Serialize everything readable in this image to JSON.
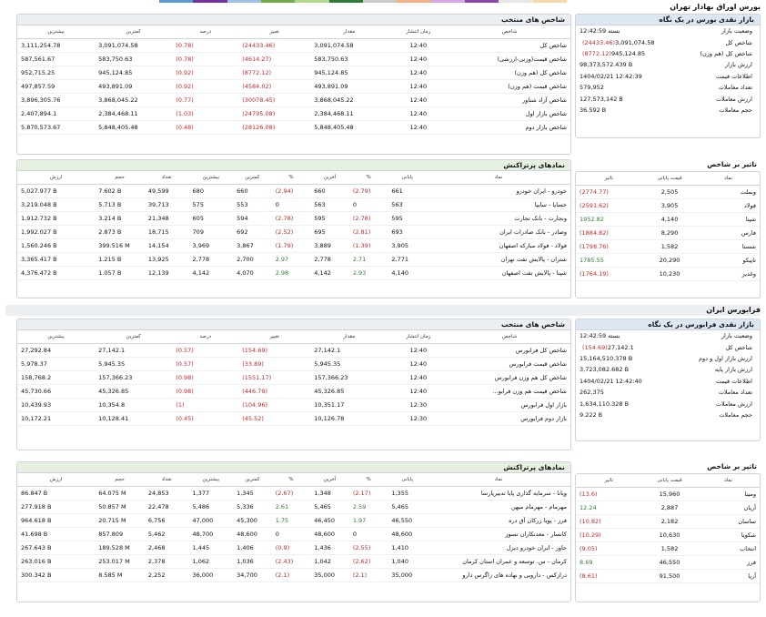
{
  "topbar_colors": [
    "#5b9bd5",
    "#7030a0",
    "#9cc3e6",
    "#70ad47",
    "#b4d88a",
    "#2e7d32",
    "#c9c9c9",
    "#f4b183",
    "#d9a7e8",
    "#8e44ad",
    "#e8e8e8",
    "#f7d6a8"
  ],
  "tse": {
    "title": "بورس اوراق بهادار تهران",
    "snapshot": {
      "title": "بازار نقدی بورس در یک نگاه",
      "rows": [
        {
          "label": "وضعیت بازار",
          "value": "بسته 12:42:59",
          "change": ""
        },
        {
          "label": "شاخص کل",
          "value": "3,091,074.58",
          "change": "(24433.46)"
        },
        {
          "label": "شاخص کل (هم وزن)",
          "value": "945,124.85",
          "change": "(8772.12)"
        },
        {
          "label": "ارزش بازار",
          "value": "98,373,572.439 B",
          "change": ""
        },
        {
          "label": "اطلاعات قیمت",
          "value": "1404/02/21 12:42:39",
          "change": ""
        },
        {
          "label": "تعداد معاملات",
          "value": "579,952",
          "change": ""
        },
        {
          "label": "ارزش معاملات",
          "value": "127,573,142 B",
          "change": ""
        },
        {
          "label": "حجم معاملات",
          "value": "36.592 B",
          "change": ""
        }
      ]
    },
    "indices": {
      "title": "شاخص های منتخب",
      "headers": [
        "شاخص",
        "زمان انتشار",
        "مقدار",
        "تغییر",
        "درصد",
        "کمترین",
        "بیشترین"
      ],
      "rows": [
        [
          "شاخص کل",
          "12:40",
          "3,091,074.58",
          "(24433.46)",
          "(0.78)",
          "3,091,074.58",
          "3,111,254.78"
        ],
        [
          "شاخص قیمت(وزنی-ارزشی)",
          "12:40",
          "583,750.63",
          "(4614.27)",
          "(0.78)",
          "583,750.63",
          "587,561.67"
        ],
        [
          "شاخص کل (هم وزن)",
          "12:40",
          "945,124.85",
          "(8772.12)",
          "(0.92)",
          "945,124.85",
          "952,715.25"
        ],
        [
          "شاخص قیمت (هم وزن)",
          "12:40",
          "493,891.09",
          "(4584.02)",
          "(0.92)",
          "493,891.09",
          "497,857.59"
        ],
        [
          "شاخص آزاد شناور",
          "12:40",
          "3,868,045.22",
          "(30078.45)",
          "(0.77)",
          "3,868,045.22",
          "3,896,305.76"
        ],
        [
          "شاخص بازار اول",
          "12:40",
          "2,384,468.11",
          "(24795.08)",
          "(1.03)",
          "2,384,468.11",
          "2,407,894.1"
        ],
        [
          "شاخص بازار دوم",
          "12:40",
          "5,848,405.48",
          "(28126.08)",
          "(0.48)",
          "5,848,405.48",
          "5,870,573.67"
        ]
      ]
    },
    "impact": {
      "title": "تاثیر بر شاخص",
      "headers": [
        "نماد",
        "قیمت پایانی",
        "تاثیر"
      ],
      "rows": [
        [
          "وبملت",
          "2,505",
          "(2774.77)"
        ],
        [
          "فولاد",
          "3,905",
          "(2591.62)"
        ],
        [
          "شپنا",
          "4,140",
          "1952.82"
        ],
        [
          "فارس",
          "8,290",
          "(1884.82)"
        ],
        [
          "شستا",
          "1,582",
          "(1798.76)"
        ],
        [
          "تاپیکو",
          "20,290",
          "1785.55"
        ],
        [
          "وغدیر",
          "10,230",
          "(1764.19)"
        ]
      ]
    },
    "active": {
      "title": "نمادهای پرتراکنش",
      "headers": [
        "نماد",
        "پایانی",
        "%",
        "آخرین",
        "%",
        "کمترین",
        "بیشترین",
        "تعداد",
        "حجم",
        "ارزش"
      ],
      "rows": [
        [
          "خودرو - ایران خودرو",
          "661",
          "(2.79)",
          "660",
          "(2.94)",
          "660",
          "680",
          "49,599",
          "7.602 B",
          "5,027.977 B"
        ],
        [
          "خسایا - سایپا",
          "563",
          "0",
          "563",
          "0",
          "553",
          "575",
          "39,713",
          "5.713 B",
          "3,219.048 B"
        ],
        [
          "ونجارت - بانک تجارت",
          "595",
          "(2.78)",
          "595",
          "(2.78)",
          "594",
          "605",
          "21,348",
          "3.214 B",
          "1,912.732 B"
        ],
        [
          "وصادر - بانک صادرات ایران",
          "693",
          "(2.81)",
          "695",
          "(2.52)",
          "692",
          "709",
          "18,715",
          "2.873 B",
          "1,992.027 B"
        ],
        [
          "فولاد - فولاد مبارکه اصفهان",
          "3,905",
          "(1.39)",
          "3,889",
          "(1.79)",
          "3,867",
          "3,969",
          "14,154",
          "399.516 M",
          "1,560.246 B"
        ],
        [
          "شتران - پالایش نفت تهران",
          "2,771",
          "2.71",
          "2,778",
          "2.97",
          "2,700",
          "2,778",
          "13,925",
          "1.215 B",
          "3,365.417 B"
        ],
        [
          "شپنا - پالایش نفت اصفهان",
          "4,140",
          "2.93",
          "4,142",
          "2.98",
          "4,070",
          "4,142",
          "12,139",
          "1.057 B",
          "4,376.472 B"
        ]
      ]
    }
  },
  "ifb": {
    "title": "فرابورس ایران",
    "snapshot": {
      "title": "بازار نقدی فرابورس در یک نگاه",
      "rows": [
        {
          "label": "وضعیت بازار",
          "value": "بسته 12:42:59",
          "change": ""
        },
        {
          "label": "شاخص کل",
          "value": "27,142.1",
          "change": "(154.69)"
        },
        {
          "label": "ارزش بازار اول و دوم",
          "value": "15,164,510.378 B",
          "change": ""
        },
        {
          "label": "ارزش بازار پایه",
          "value": "3,723,082.682 B",
          "change": ""
        },
        {
          "label": "اطلاعات قیمت",
          "value": "1404/02/21 12:42:40",
          "change": ""
        },
        {
          "label": "تعداد معاملات",
          "value": "262,375",
          "change": ""
        },
        {
          "label": "ارزش معاملات",
          "value": "1,634,110.328 B",
          "change": ""
        },
        {
          "label": "حجم معاملات",
          "value": "9.222 B",
          "change": ""
        }
      ]
    },
    "indices": {
      "title": "شاخص های منتخب",
      "headers": [
        "شاخص",
        "زمان انتشار",
        "مقدار",
        "تغییر",
        "درصد",
        "کمترین",
        "بیشترین"
      ],
      "rows": [
        [
          "شاخص کل فرابورس",
          "12:40",
          "27,142.1",
          "(154.69)",
          "(0.57)",
          "27,142.1",
          "27,292.84"
        ],
        [
          "شاخص قیمت فرابورس",
          "12:40",
          "5,945.35",
          "(33.89)",
          "(0.57)",
          "5,945.35",
          "5,978.37"
        ],
        [
          "شاخص کل هم وزن فرابورس",
          "12:40",
          "157,366.23",
          "(1551.17)",
          "(0.98)",
          "157,366.23",
          "158,768.2"
        ],
        [
          "شاخص قیمت هم وزن فرابو...",
          "12:40",
          "45,326.85",
          "(446.79)",
          "(0.98)",
          "45,326.85",
          "45,730.66"
        ],
        [
          "بازار اول فرابورس",
          "12:30",
          "10,351.17",
          "(104.96)",
          "(1)",
          "10,354.8",
          "10,439.93"
        ],
        [
          "بازار دوم فرابورس",
          "12:30",
          "10,126.78",
          "(45.52)",
          "(0.45)",
          "10,128.41",
          "10,172.21"
        ]
      ]
    },
    "impact": {
      "title": "تاثیر بر شاخص",
      "headers": [
        "نماد",
        "قیمت پایانی",
        "تاثیر"
      ],
      "rows": [
        [
          "ومینا",
          "15,960",
          "(13.6)"
        ],
        [
          "آریان",
          "2,887",
          "12.24"
        ],
        [
          "ساسان",
          "2,182",
          "(10.82)"
        ],
        [
          "شکویا",
          "10,630",
          "(10.29)"
        ],
        [
          "انتخاب",
          "1,582",
          "(9.05)"
        ],
        [
          "فرز",
          "46,550",
          "8.69"
        ],
        [
          "آریا",
          "91,500",
          "(8.61)"
        ]
      ]
    },
    "active": {
      "title": "نمادهای پرتراکنش",
      "headers": [
        "نماد",
        "پایانی",
        "%",
        "آخرین",
        "%",
        "کمترین",
        "بیشترین",
        "تعداد",
        "حجم",
        "ارزش"
      ],
      "rows": [
        [
          "ویانا - سرمایه گذاری پایا تدبیرپارسا",
          "1,355",
          "(2.17)",
          "1,348",
          "(2.67)",
          "1,345",
          "1,377",
          "24,853",
          "64.075 M",
          "86.847 B"
        ],
        [
          "مهرمام - مهرمام میهن",
          "5,465",
          "2.59",
          "5,465",
          "2.61",
          "5,336",
          "5,486",
          "22,478",
          "50.857 M",
          "277.918 B"
        ],
        [
          "فرز - پویا زرکان آق دره",
          "46,550",
          "1.97",
          "46,450",
          "1.75",
          "45,300",
          "47,000",
          "6,756",
          "20.715 M",
          "964.618 B"
        ],
        [
          "کانسار - معدنکاران نسوز",
          "48,600",
          "0",
          "48,600",
          "0",
          "48,600",
          "48,700",
          "5,462",
          "857.809",
          "41.698 B"
        ],
        [
          "حاور - ایران خودرو دیزل",
          "1,410",
          "(2.55)",
          "1,436",
          "(0.9)",
          "1,406",
          "1,445",
          "2,468",
          "189.528 M",
          "267.643 B"
        ],
        [
          "کرمان - س. توسعه و عمران استان کرمان",
          "1,040",
          "(2.62)",
          "1,042",
          "(2.43)",
          "1,036",
          "1,062",
          "2,378",
          "253.017 M",
          "263.016 B"
        ],
        [
          "درازکس - دارویی و نهاده های زاگرس دارو",
          "35,000",
          "(2.1)",
          "35,000",
          "(2.1)",
          "34,700",
          "36,000",
          "2,252",
          "8.585 M",
          "300.342 B"
        ]
      ]
    }
  }
}
